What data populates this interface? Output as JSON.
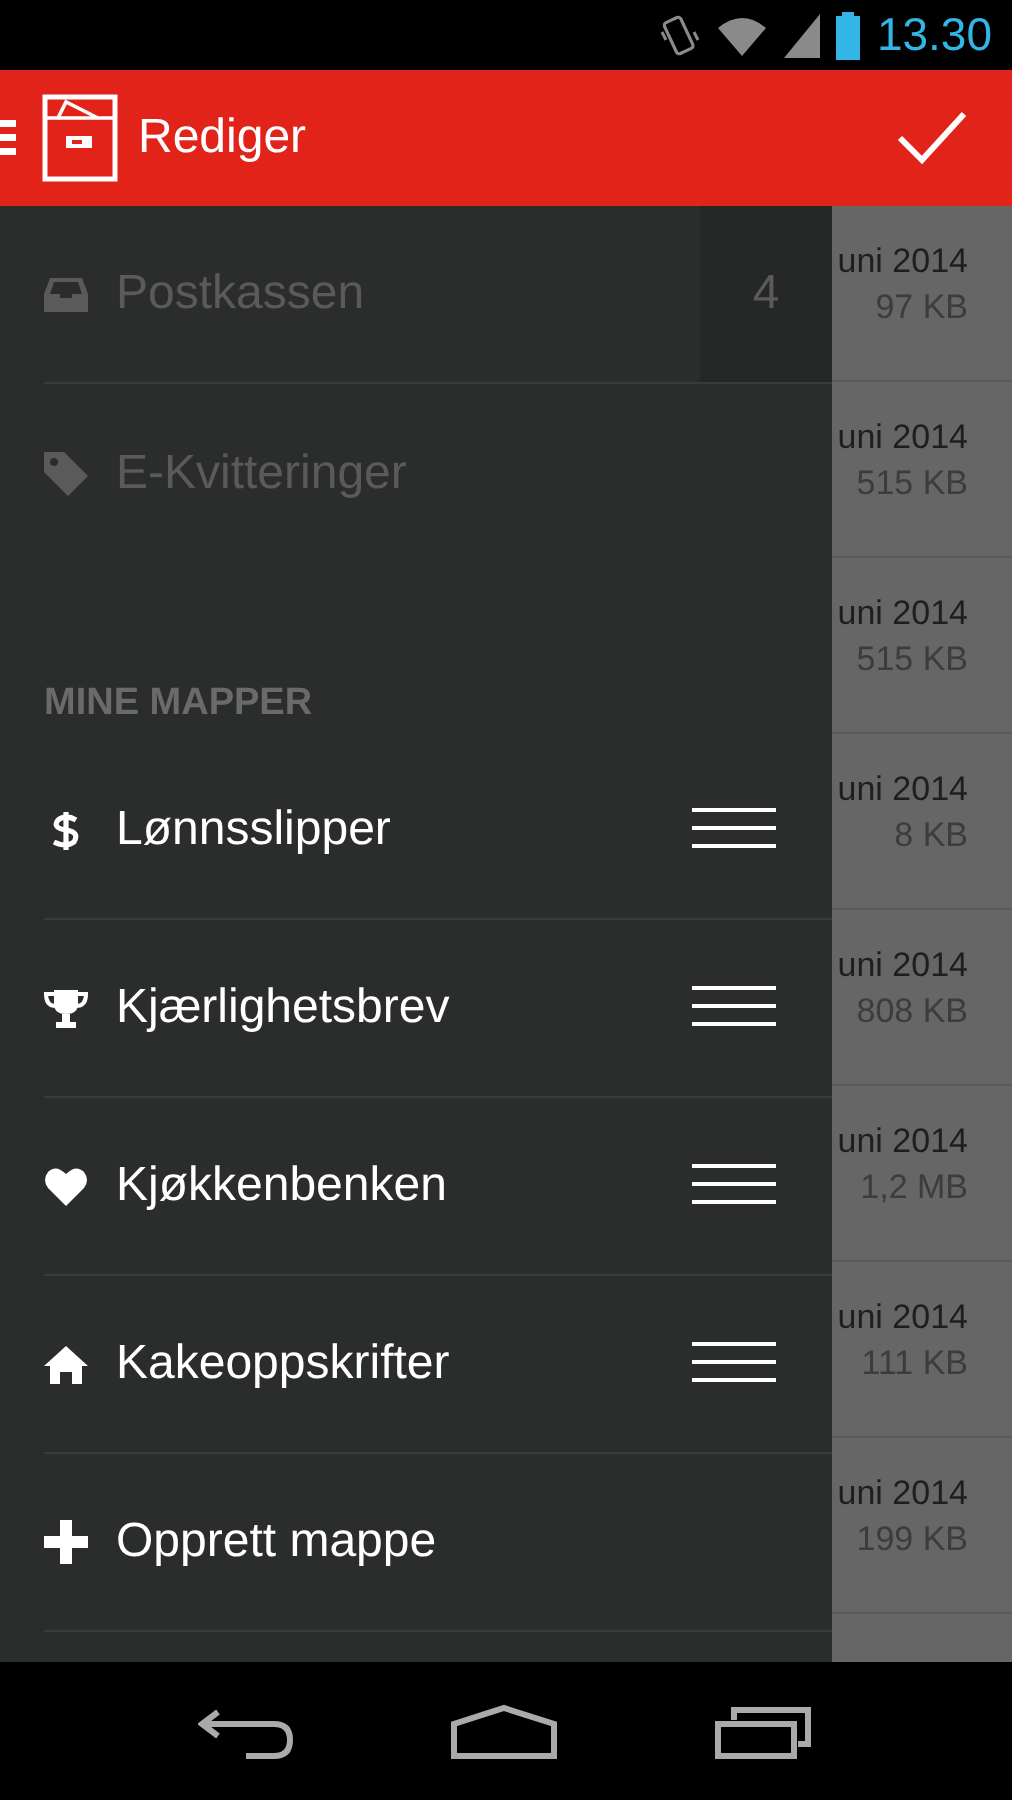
{
  "status_bar": {
    "time": "13.30"
  },
  "app_bar": {
    "title": "Rediger"
  },
  "drawer": {
    "items": [
      {
        "label": "Postkassen",
        "count": "4",
        "disabled": true
      },
      {
        "label": "E-Kvitteringer",
        "disabled": true
      }
    ],
    "section_title": "MINE MAPPER",
    "folders": [
      {
        "label": "Lønnsslipper"
      },
      {
        "label": "Kjærlighetsbrev"
      },
      {
        "label": "Kjøkkenbenken"
      },
      {
        "label": "Kakeoppskrifter"
      }
    ],
    "create_button": "Opprett mappe"
  },
  "documents": [
    {
      "date": "uni 2014",
      "size": "97 KB"
    },
    {
      "date": "uni 2014",
      "size": "515 KB"
    },
    {
      "date": "uni 2014",
      "size": "515 KB"
    },
    {
      "date": "uni 2014",
      "size": "8 KB"
    },
    {
      "date": "uni 2014",
      "size": "808 KB"
    },
    {
      "date": "uni 2014",
      "size": "1,2 MB"
    },
    {
      "date": "uni 2014",
      "size": "111 KB"
    },
    {
      "date": "uni 2014",
      "size": "199 KB"
    }
  ]
}
